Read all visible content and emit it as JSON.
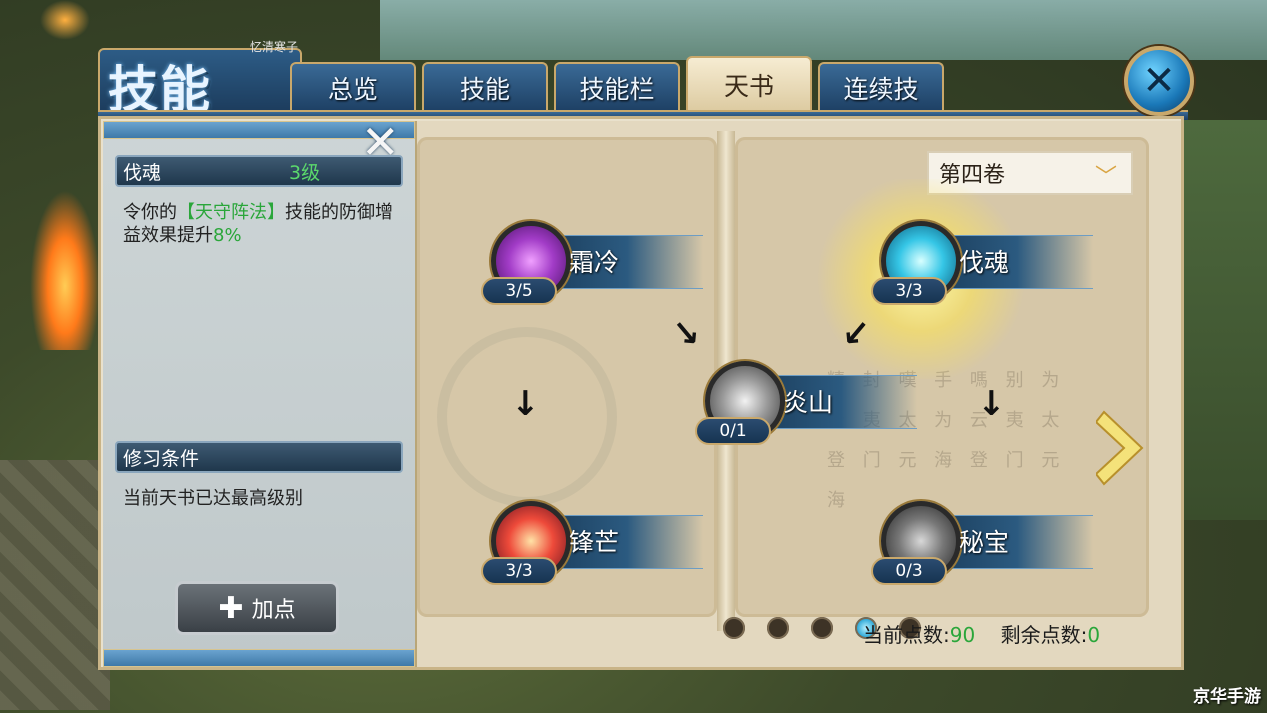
{
  "window": {
    "title": "技能",
    "subtitle": "忆清寒子",
    "tabs": [
      "总览",
      "技能",
      "技能栏",
      "天书",
      "连续技"
    ],
    "active_tab": "天书"
  },
  "info_panel": {
    "skill_name": "伐魂",
    "skill_level": "3级",
    "description_prefix": "令你的",
    "description_highlight": "【天守阵法】",
    "description_mid": "技能的防御增益效果提升",
    "description_value": "8%",
    "condition_header": "修习条件",
    "condition_text": "当前天书已达最高级别",
    "add_point_label": "加点"
  },
  "book": {
    "volume": "第四卷",
    "skills": [
      {
        "name": "霜冷",
        "count": "3/5",
        "icon": "frost-skill-icon"
      },
      {
        "name": "伐魂",
        "count": "3/3",
        "icon": "soul-skill-icon"
      },
      {
        "name": "炎山",
        "count": "0/1",
        "icon": "flame-mountain-skill-icon"
      },
      {
        "name": "锋芒",
        "count": "3/3",
        "icon": "edge-skill-icon"
      },
      {
        "name": "秘宝",
        "count": "0/3",
        "icon": "treasure-skill-icon"
      }
    ],
    "page_dots": 5,
    "active_page": 4,
    "current_points_label": "当前点数:",
    "current_points_value": "90",
    "remaining_points_label": "剩余点数:",
    "remaining_points_value": "0",
    "faint_text": "精 封 嘆 手 嗎 别 为 云 夷 太 为 云 夷 太 登 门 元 海 登 门 元 海"
  },
  "watermark": "京华手游",
  "colors": {
    "accent": "#2aa63a",
    "tab_blue": "#2b5a80",
    "gold_border": "#c9a86b"
  }
}
